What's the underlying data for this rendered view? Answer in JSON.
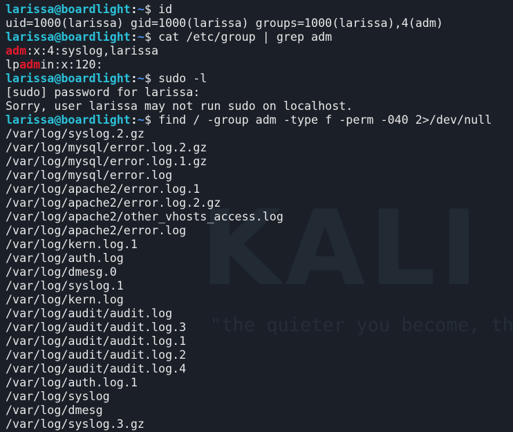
{
  "watermark": {
    "logo": "KALI LINUX",
    "tagline": "\"the quieter you become, the more you are able to hear\""
  },
  "colors": {
    "background": "#1b2028",
    "text": "#e8e8e8",
    "prompt_user": "#2bc1d9",
    "prompt_path": "#4f8ff0",
    "match_highlight": "#e8172b"
  },
  "prompt": {
    "user_host": "larissa@boardlight",
    "separator": ":",
    "path": "~",
    "symbol": "$"
  },
  "lines": [
    {
      "type": "cmd",
      "text": " id"
    },
    {
      "type": "out",
      "text": "uid=1000(larissa) gid=1000(larissa) groups=1000(larissa),4(adm)"
    },
    {
      "type": "cmd",
      "text": " cat /etc/group | grep adm"
    },
    {
      "type": "grep",
      "parts": [
        {
          "text": "adm",
          "hl": true
        },
        {
          "text": ":x:4:syslog,larissa",
          "hl": false
        }
      ]
    },
    {
      "type": "grep",
      "parts": [
        {
          "text": "lp",
          "hl": false
        },
        {
          "text": "adm",
          "hl": true
        },
        {
          "text": "in:x:120:",
          "hl": false
        }
      ]
    },
    {
      "type": "cmd",
      "text": " sudo -l"
    },
    {
      "type": "out",
      "text": "[sudo] password for larissa:"
    },
    {
      "type": "out",
      "text": "Sorry, user larissa may not run sudo on localhost."
    },
    {
      "type": "cmd",
      "text": " find / -group adm -type f -perm -040 2>/dev/null"
    },
    {
      "type": "out",
      "text": "/var/log/syslog.2.gz"
    },
    {
      "type": "out",
      "text": "/var/log/mysql/error.log.2.gz"
    },
    {
      "type": "out",
      "text": "/var/log/mysql/error.log.1.gz"
    },
    {
      "type": "out",
      "text": "/var/log/mysql/error.log"
    },
    {
      "type": "out",
      "text": "/var/log/apache2/error.log.1"
    },
    {
      "type": "out",
      "text": "/var/log/apache2/error.log.2.gz"
    },
    {
      "type": "out",
      "text": "/var/log/apache2/other_vhosts_access.log"
    },
    {
      "type": "out",
      "text": "/var/log/apache2/error.log"
    },
    {
      "type": "out",
      "text": "/var/log/kern.log.1"
    },
    {
      "type": "out",
      "text": "/var/log/auth.log"
    },
    {
      "type": "out",
      "text": "/var/log/dmesg.0"
    },
    {
      "type": "out",
      "text": "/var/log/syslog.1"
    },
    {
      "type": "out",
      "text": "/var/log/kern.log"
    },
    {
      "type": "out",
      "text": "/var/log/audit/audit.log"
    },
    {
      "type": "out",
      "text": "/var/log/audit/audit.log.3"
    },
    {
      "type": "out",
      "text": "/var/log/audit/audit.log.1"
    },
    {
      "type": "out",
      "text": "/var/log/audit/audit.log.2"
    },
    {
      "type": "out",
      "text": "/var/log/audit/audit.log.4"
    },
    {
      "type": "out",
      "text": "/var/log/auth.log.1"
    },
    {
      "type": "out",
      "text": "/var/log/syslog"
    },
    {
      "type": "out",
      "text": "/var/log/dmesg"
    },
    {
      "type": "out",
      "text": "/var/log/syslog.3.gz"
    }
  ]
}
